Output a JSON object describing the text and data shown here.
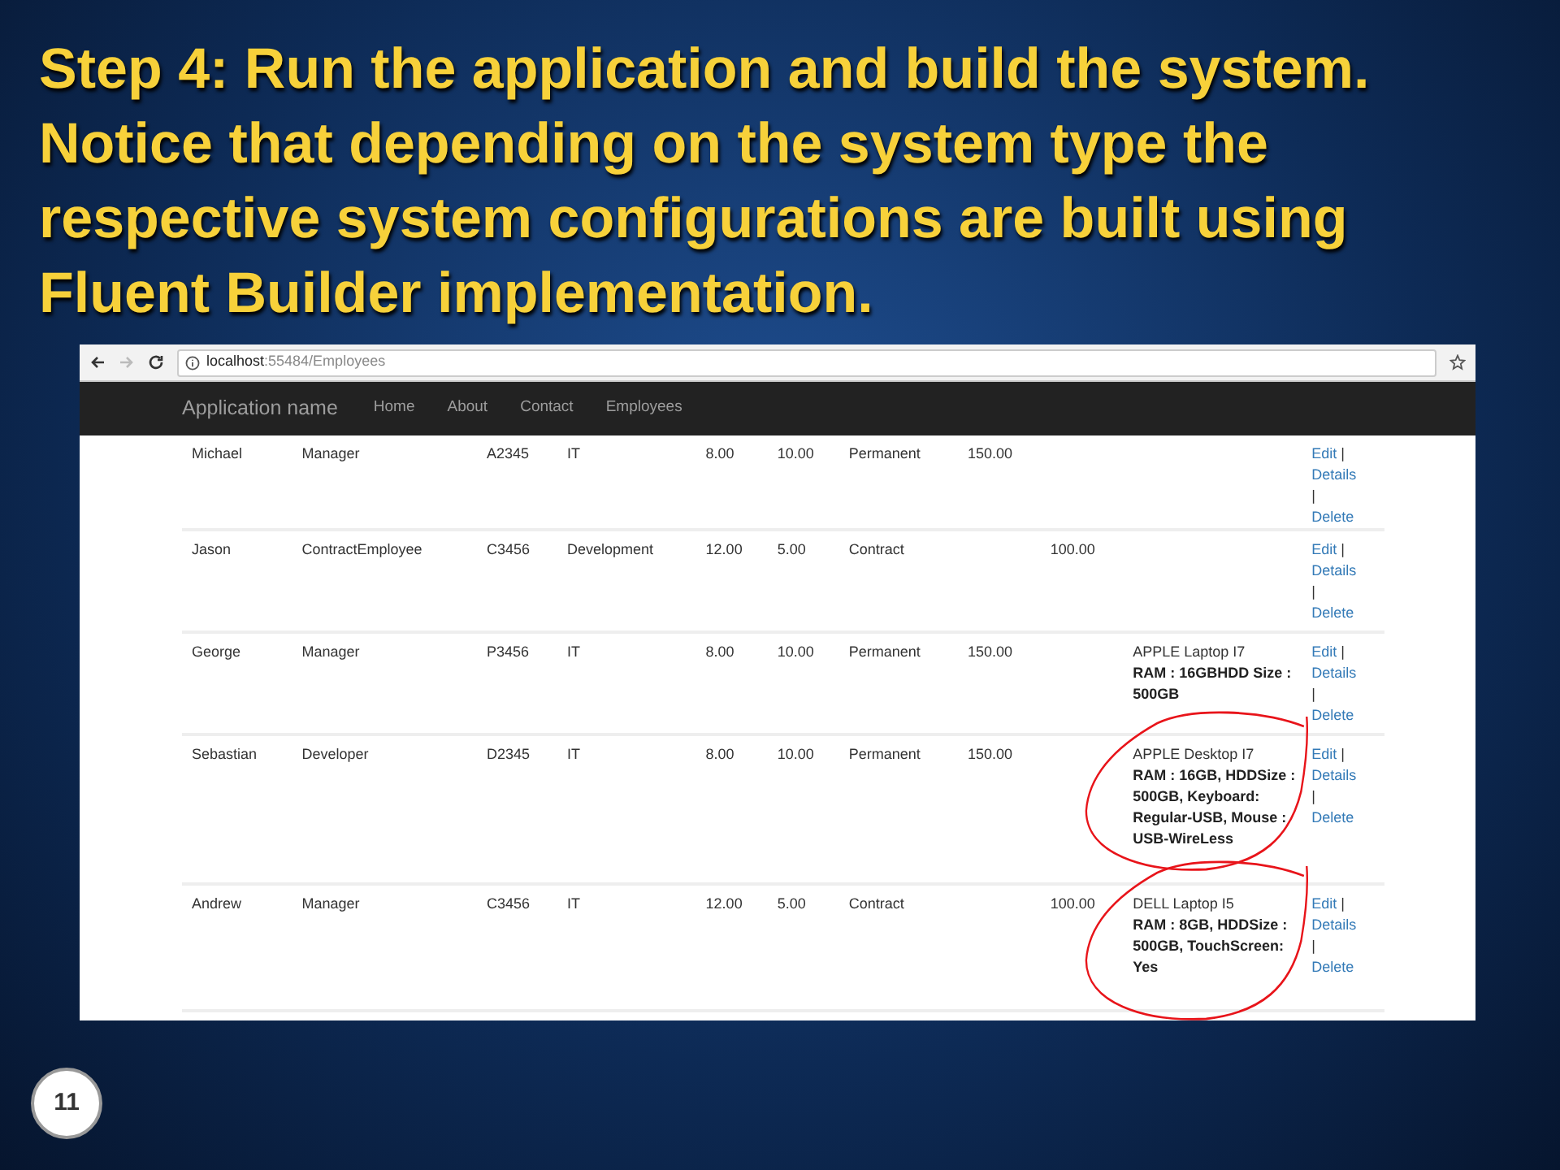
{
  "slide": {
    "title": "Step 4: Run the application and build the system. Notice that depending on the system type the respective system configurations are built using Fluent Builder implementation.",
    "page_number": "11"
  },
  "browser": {
    "url_host": "localhost",
    "url_rest": ":55484/Employees"
  },
  "navbar": {
    "brand": "Application name",
    "links": [
      "Home",
      "About",
      "Contact",
      "Employees"
    ]
  },
  "table": {
    "rows": [
      {
        "cells": [
          "Michael",
          "Manager",
          "A2345",
          "IT",
          "8.00",
          "10.00",
          "Permanent",
          "150.00",
          ""
        ],
        "config": null,
        "circled": false,
        "actions": [
          "Edit",
          "|",
          "Details",
          "|",
          "Delete"
        ]
      },
      {
        "cells": [
          "Jason",
          "ContractEmployee",
          "C3456",
          "Development",
          "12.00",
          "5.00",
          "Contract",
          "",
          "100.00"
        ],
        "config": null,
        "circled": false,
        "actions": [
          "Edit",
          "|",
          "Details",
          "|",
          "Delete"
        ]
      },
      {
        "cells": [
          "George",
          "Manager",
          "P3456",
          "IT",
          "8.00",
          "10.00",
          "Permanent",
          "150.00",
          ""
        ],
        "config": {
          "model": "APPLE Laptop I7",
          "specs": "RAM : 16GBHDD Size : 500GB"
        },
        "circled": false,
        "actions": [
          "Edit",
          "|",
          "Details",
          "|",
          "Delete"
        ]
      },
      {
        "cells": [
          "Sebastian",
          "Developer",
          "D2345",
          "IT",
          "8.00",
          "10.00",
          "Permanent",
          "150.00",
          ""
        ],
        "config": {
          "model": "APPLE Desktop I7",
          "specs": "RAM : 16GB, HDDSize : 500GB, Keyboard: Regular-USB, Mouse : USB-WireLess"
        },
        "circled": true,
        "actions": [
          "Edit",
          "|",
          "Details",
          "|",
          "Delete"
        ]
      },
      {
        "cells": [
          "Andrew",
          "Manager",
          "C3456",
          "IT",
          "12.00",
          "5.00",
          "Contract",
          "",
          "100.00"
        ],
        "config": {
          "model": "DELL Laptop I5",
          "specs": "RAM : 8GB, HDDSize : 500GB, TouchScreen: Yes"
        },
        "circled": true,
        "actions": [
          "Edit",
          "|",
          "Details",
          "|",
          "Delete"
        ]
      }
    ]
  }
}
